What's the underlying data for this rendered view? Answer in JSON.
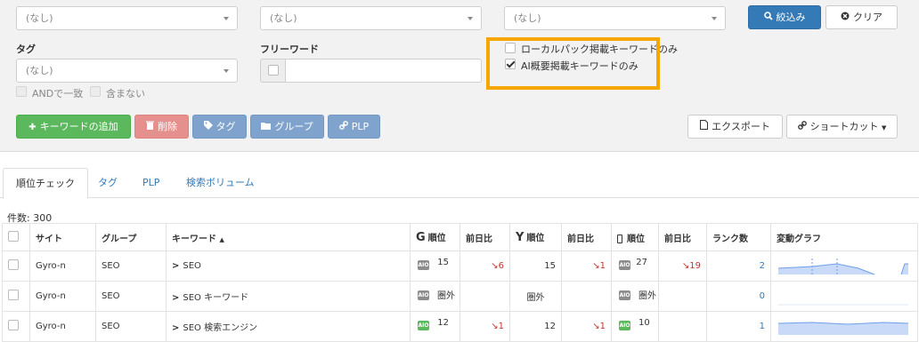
{
  "filters": {
    "select1": "(なし)",
    "select2": "(なし)",
    "select3": "(なし)",
    "tag_label": "タグ",
    "tag_select": "(なし)",
    "freeword_label": "フリーワード",
    "freeword_value": "",
    "and_label": "ANDで一致",
    "exclude_label": "含まない",
    "local_pack_label": "ローカルパック掲載キーワードのみ",
    "ai_overview_label": "AI概要掲載キーワードのみ"
  },
  "buttons": {
    "search": "絞込み",
    "clear": "クリア",
    "add_keyword": "キーワードの追加",
    "delete": "削除",
    "tag": "タグ",
    "group": "グループ",
    "plp": "PLP",
    "export": "エクスポート",
    "shortcut": "ショートカット"
  },
  "tabs": [
    "順位チェック",
    "タグ",
    "PLP",
    "検索ボリューム"
  ],
  "count_text": "件数: 300",
  "table": {
    "headers": {
      "site": "サイト",
      "group": "グループ",
      "keyword": "キーワード",
      "google_rank": "順位",
      "google_prev": "前日比",
      "yahoo_rank": "順位",
      "yahoo_prev": "前日比",
      "mobile_rank": "順位",
      "mobile_prev": "前日比",
      "rank_count": "ランク数",
      "graph": "変動グラフ"
    },
    "rows": [
      {
        "site": "Gyro-n",
        "group": "SEO",
        "keyword": "SEO",
        "g_badge": "AIO",
        "g_green": false,
        "g_rank": "15",
        "g_prev": "↘6",
        "y_rank": "15",
        "y_prev": "↘1",
        "m_badge": "AIO",
        "m_green": false,
        "m_rank": "27",
        "m_prev": "↘19",
        "rank_count": "2"
      },
      {
        "site": "Gyro-n",
        "group": "SEO",
        "keyword": "SEO キーワード",
        "g_badge": "AIO",
        "g_green": false,
        "g_rank": "圏外",
        "g_prev": "",
        "y_rank": "圏外",
        "y_prev": "",
        "m_badge": "AIO",
        "m_green": false,
        "m_rank": "圏外",
        "m_prev": "",
        "rank_count": "0"
      },
      {
        "site": "Gyro-n",
        "group": "SEO",
        "keyword": "SEO 検索エンジン",
        "g_badge": "AIO",
        "g_green": true,
        "g_rank": "12",
        "g_prev": "↘1",
        "y_rank": "12",
        "y_prev": "↘1",
        "m_badge": "AIO",
        "m_green": true,
        "m_rank": "10",
        "m_prev": "",
        "rank_count": "1"
      }
    ]
  },
  "colors": {
    "primary": "#337ab7",
    "success": "#5cb85c",
    "danger_light": "#e5908d",
    "info_muted": "#7fa3cc",
    "highlight": "#f5a700",
    "sparkline_fill": "#c9daf8",
    "sparkline_line": "#6d9eeb"
  }
}
